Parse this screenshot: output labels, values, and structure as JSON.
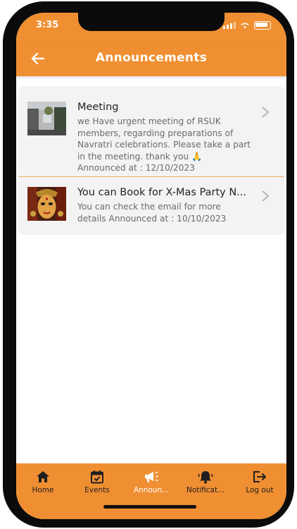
{
  "status": {
    "time": "3:35"
  },
  "header": {
    "title": "Announcements",
    "back_icon": "arrow-left-icon"
  },
  "announcements": [
    {
      "title": "Meeting",
      "body": "we Have urgent meeting of RSUK members, regarding preparations of Navratri celebrations. Please take a part in the meeting. thank you 🙏",
      "announced": "Announced at : 12/10/2023",
      "thumbnail": "building-photo"
    },
    {
      "title": "You can Book for X-Mas Party N...",
      "body": "You can check the email for more details",
      "announced": "Announced at : 10/10/2023",
      "thumbnail": "goddess-painting-photo"
    }
  ],
  "tabs": [
    {
      "label": "Home",
      "icon": "home-icon"
    },
    {
      "label": "Events",
      "icon": "calendar-check-icon"
    },
    {
      "label": "Announ...",
      "icon": "megaphone-icon"
    },
    {
      "label": "Notificat...",
      "icon": "bell-icon"
    },
    {
      "label": "Log out",
      "icon": "logout-icon"
    }
  ],
  "colors": {
    "accent": "#f08f32",
    "divider": "#f0b36c",
    "card": "#f3f3f3"
  }
}
